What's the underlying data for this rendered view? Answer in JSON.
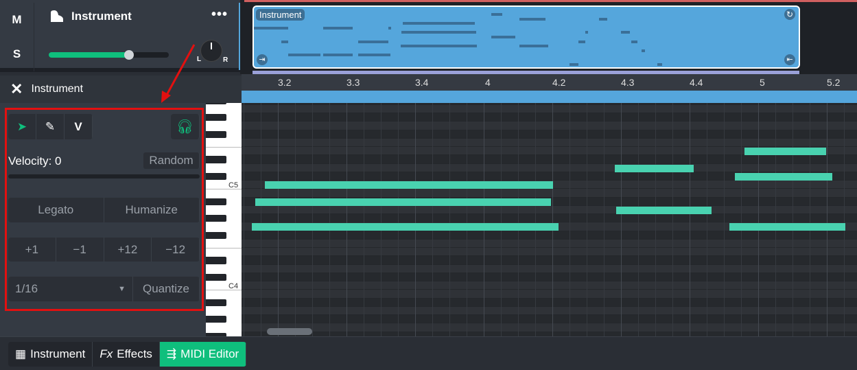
{
  "track": {
    "mute_label": "M",
    "solo_label": "S",
    "name": "Instrument",
    "more_icon": "more-dots-icon",
    "volume": 0.67,
    "pan_left": "L",
    "pan_right": "R",
    "pan": 0
  },
  "clip": {
    "name": "Instrument",
    "color": "#55a6dc",
    "notes": [
      [
        0.65,
        0.5,
        3
      ],
      [
        1.05,
        0.1,
        6
      ],
      [
        1.15,
        0.47,
        9
      ],
      [
        1.66,
        0.43,
        3
      ],
      [
        1.66,
        0.43,
        9
      ],
      [
        2.17,
        0.44,
        6
      ],
      [
        2.17,
        0.47,
        9
      ],
      [
        2.61,
        0.03,
        3
      ],
      [
        2.82,
        1.05,
        2
      ],
      [
        2.8,
        1.09,
        4
      ],
      [
        2.79,
        1.11,
        7
      ],
      [
        4.11,
        0.16,
        0
      ],
      [
        4.11,
        0.35,
        5
      ],
      [
        4.52,
        0.38,
        1
      ],
      [
        4.52,
        0.42,
        7
      ],
      [
        5.25,
        0.13,
        11
      ],
      [
        5.38,
        0.1,
        6
      ],
      [
        5.48,
        0.04,
        4
      ],
      [
        5.68,
        0.12,
        1
      ],
      [
        6.0,
        0.13,
        4
      ],
      [
        6.15,
        0.09,
        6
      ],
      [
        6.3,
        0.05,
        8
      ],
      [
        6.53,
        0.07,
        11
      ]
    ]
  },
  "editor": {
    "title": "Instrument",
    "ruler": [
      "3.2",
      "3.3",
      "3.4",
      "4",
      "4.2",
      "4.3",
      "4.4",
      "5",
      "5.2"
    ],
    "key_labels": {
      "c5": "C5",
      "c4": "C4"
    },
    "notes": [
      {
        "pitch": 76,
        "start": 7.8,
        "length": 1.19
      },
      {
        "pitch": 74,
        "start": 5.91,
        "length": 1.15
      },
      {
        "pitch": 73,
        "start": 7.66,
        "length": 1.42
      },
      {
        "pitch": 72,
        "start": 0.81,
        "length": 4.2
      },
      {
        "pitch": 70,
        "start": 0.67,
        "length": 4.31
      },
      {
        "pitch": 69,
        "start": 5.93,
        "length": 1.39
      },
      {
        "pitch": 67,
        "start": 0.62,
        "length": 4.47
      },
      {
        "pitch": 67,
        "start": 7.58,
        "length": 1.69
      }
    ],
    "note_color": "#49d2b0"
  },
  "tools": {
    "select_icon": "cursor-arrow-icon",
    "pencil_icon": "pencil-icon",
    "velocity_tool": "V",
    "listen_icon": "headphones-icon",
    "velocity_label": "Velocity: 0",
    "random": "Random",
    "legato": "Legato",
    "humanize": "Humanize",
    "transpose": [
      "+1",
      "−1",
      "+12",
      "−12"
    ],
    "grid_value": "1/16",
    "quantize": "Quantize"
  },
  "bottom_tabs": [
    {
      "icon": "▦",
      "label": "Instrument"
    },
    {
      "icon": "Fx",
      "label": "Effects"
    },
    {
      "icon": "⇶",
      "label": "MIDI Editor",
      "active": true
    }
  ],
  "accent": "#0fbf7d"
}
